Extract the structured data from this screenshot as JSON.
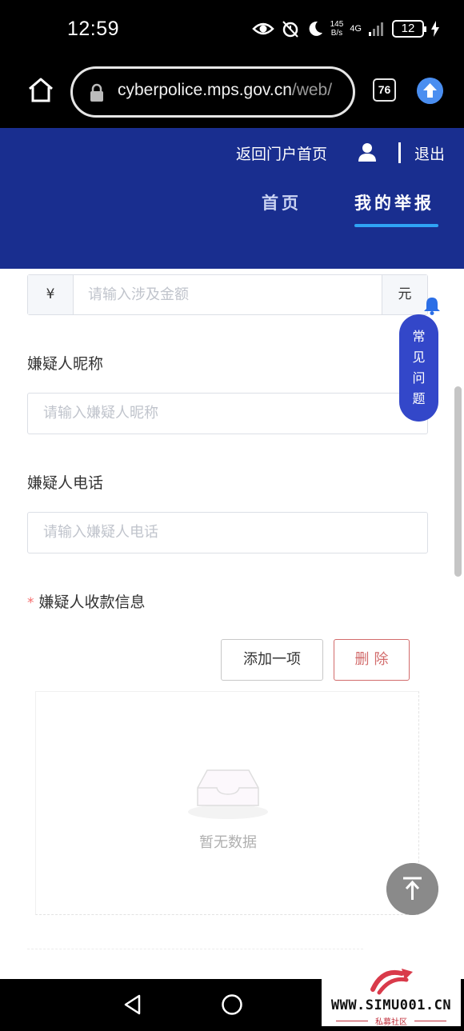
{
  "status_bar": {
    "time": "12:59",
    "speed_value": "145",
    "speed_unit": "B/s",
    "network": "4G",
    "battery": "12"
  },
  "browser": {
    "url_main": "cyberpolice.mps.gov.cn",
    "url_dim": "/web/",
    "tab_count": "76"
  },
  "header": {
    "back_to_portal": "返回门户首页",
    "logout": "退出",
    "nav": {
      "home": "首页",
      "my_report": "我的举报"
    },
    "accent_color": "#2fa4f5"
  },
  "form": {
    "amount": {
      "prefix": "¥",
      "placeholder": "请输入涉及金额",
      "suffix": "元"
    },
    "suspect_nickname": {
      "label": "嫌疑人昵称",
      "placeholder": "请输入嫌疑人昵称"
    },
    "suspect_phone": {
      "label": "嫌疑人电话",
      "placeholder": "请输入嫌疑人电话"
    },
    "suspect_payment": {
      "required_mark": "*",
      "label": "嫌疑人收款信息",
      "add_button": "添加一项",
      "delete_button": "删除",
      "empty_text": "暂无数据"
    }
  },
  "floating": {
    "faq_chars": [
      "常",
      "见",
      "问",
      "题"
    ]
  },
  "watermark": {
    "url": "WWW.SIMU001.CN",
    "sub": "私募社区"
  }
}
